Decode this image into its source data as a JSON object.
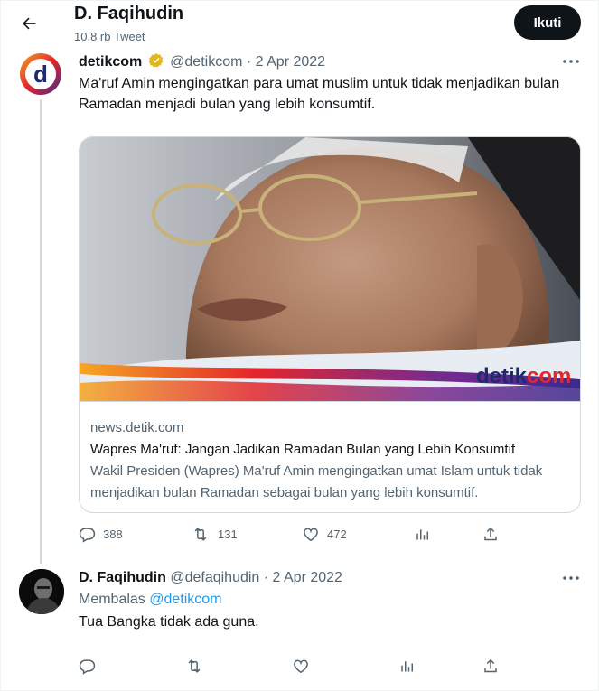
{
  "header": {
    "title": "D. Faqihudin",
    "tweet_count": "10,8 rb Tweet",
    "follow_label": "Ikuti"
  },
  "tweet1": {
    "display_name": "detikcom",
    "handle": "@detikcom",
    "separator": "·",
    "date": "2 Apr 2022",
    "avatar_letter": "d",
    "text": "Ma'ruf Amin mengingatkan para umat muslim untuk tidak menjadikan bulan Ramadan menjadi bulan yang lebih konsumtif.",
    "card": {
      "watermark_part1": "detik",
      "watermark_part2": "com",
      "domain": "news.detik.com",
      "title": "Wapres Ma'ruf: Jangan Jadikan Ramadan Bulan yang Lebih Konsumtif",
      "description": "Wakil Presiden (Wapres) Ma'ruf Amin mengingatkan umat Islam untuk tidak menjadikan bulan Ramadan sebagai bulan yang lebih konsumtif."
    },
    "stats": {
      "replies": "388",
      "retweets": "131",
      "likes": "472"
    }
  },
  "tweet2": {
    "display_name": "D. Faqihudin",
    "handle": "@defaqihudin",
    "separator": "·",
    "date": "2 Apr 2022",
    "replying_label": "Membalas",
    "replying_to": "@detikcom",
    "text": "Tua Bangka tidak ada guna."
  },
  "icons": {
    "back": "arrow-left-icon",
    "verified": "verified-gold-badge-icon",
    "more": "more-horizontal-icon",
    "reply": "reply-icon",
    "retweet": "retweet-icon",
    "like": "heart-icon",
    "views": "analytics-icon",
    "share": "share-icon"
  },
  "colors": {
    "link": "#1d9bf0",
    "muted": "#536471",
    "follow_bg": "#0f1419",
    "verified_gold": "#e2b719",
    "detik_red": "#e3262c"
  }
}
